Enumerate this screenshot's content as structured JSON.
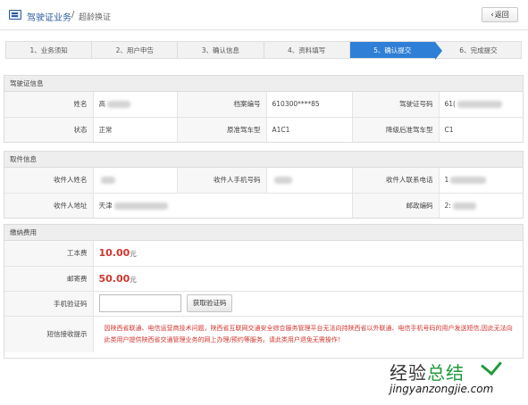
{
  "header": {
    "app_title": "驾驶证业务",
    "separator": "/",
    "subtitle": "超龄换证",
    "back_label": "返回",
    "back_icon": "chevron-left"
  },
  "steps": [
    {
      "label": "1、业务须知",
      "active": false
    },
    {
      "label": "2、用户申告",
      "active": false
    },
    {
      "label": "3、确认信息",
      "active": false
    },
    {
      "label": "4、资料填写",
      "active": false
    },
    {
      "label": "5、确认提交",
      "active": true
    },
    {
      "label": "6、完成提交",
      "active": false
    }
  ],
  "license_info": {
    "heading": "驾驶证信息",
    "name_label": "姓名",
    "name_value": "高",
    "file_no_label": "档案编号",
    "file_no_value": "610300****85",
    "license_no_label": "驾驶证号码",
    "license_no_value": "61(",
    "status_label": "状态",
    "status_value": "正常",
    "orig_class_label": "原准驾车型",
    "orig_class_value": "A1C1",
    "new_class_label": "降级后准驾车型",
    "new_class_value": "C1"
  },
  "recipient_info": {
    "heading": "取件信息",
    "name_label": "收件人姓名",
    "name_value": "",
    "mobile_label": "收件人手机号码",
    "mobile_value": "",
    "phone_label": "收件人联系电话",
    "phone_value": "1",
    "address_label": "收件人地址",
    "address_value": "天津",
    "postcode_label": "邮政编码",
    "postcode_value": "2:"
  },
  "fees": {
    "heading": "缴纳费用",
    "cost_label": "工本费",
    "cost_value": "10.00",
    "cost_unit": "元",
    "postage_label": "邮寄费",
    "postage_value": "50.00",
    "postage_unit": "元",
    "code_label": "手机验证码",
    "code_input_value": "",
    "get_code_label": "获取验证码",
    "notice_label": "短信接收提示",
    "notice_text": "因陕西省联通、电信运营商技术问题，陕西省互联网交通安全综合服务管理平台无法向持陕西省以外联通、电信手机号码的用户发送短信,因此无法向此类用户提供陕西省交通管理业务的网上办理/预约等服务。请此类用户退免无需操作！",
    "notice_color": "#d0352c"
  },
  "watermark": {
    "text_black": "经验",
    "text_green": "总结",
    "url": "jingyanzongjie.com",
    "accent": "#1f9a3a"
  }
}
